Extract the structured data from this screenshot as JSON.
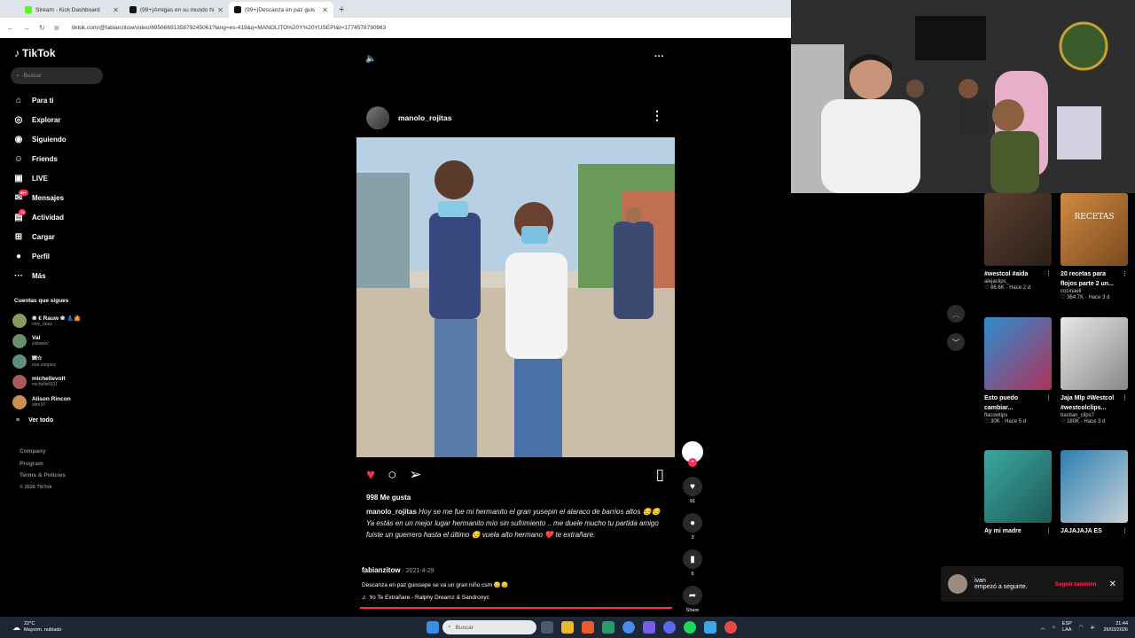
{
  "browser": {
    "tabs": [
      {
        "title": "Stream - Kick Dashboard",
        "color": "#53fc18",
        "active": false
      },
      {
        "title": "(99+)Amigas en su mundo hist",
        "color": "#111111",
        "active": false
      },
      {
        "title": "(99+)Descanza en paz guis",
        "color": "#111111",
        "active": true
      }
    ],
    "url": "tiktok.com/@fabianzitow/video/6956669135879245061?lang=es-419&q=MANOLITO%20Y%20YUSEPI&t=1774578790963"
  },
  "sidebar": {
    "logo": "TikTok",
    "search_placeholder": "Buscar",
    "nav": [
      {
        "icon": "home-icon",
        "glyph": "⌂",
        "label": "Para ti"
      },
      {
        "icon": "compass-icon",
        "glyph": "◎",
        "label": "Explorar"
      },
      {
        "icon": "following-icon",
        "glyph": "◉",
        "label": "Siguiendo"
      },
      {
        "icon": "friends-icon",
        "glyph": "☺",
        "label": "Friends"
      },
      {
        "icon": "live-icon",
        "glyph": "▣",
        "label": "LIVE"
      },
      {
        "icon": "messages-icon",
        "glyph": "✉",
        "label": "Mensajes",
        "badge": "99+"
      },
      {
        "icon": "activity-icon",
        "glyph": "▤",
        "label": "Actividad",
        "badge": "72"
      },
      {
        "icon": "upload-icon",
        "glyph": "⊞",
        "label": "Cargar"
      },
      {
        "icon": "profile-icon",
        "glyph": "●",
        "label": "Perfil"
      },
      {
        "icon": "more-icon",
        "glyph": "···",
        "label": "Más"
      }
    ],
    "following_title": "Cuentas que sigues",
    "following": [
      {
        "name": "❀ € Rauw ❀ 👗🤷",
        "handle": "only_rauw",
        "color": "#8a9a5b"
      },
      {
        "name": "Val",
        "handle": "ysliawvv",
        "color": "#6b8e6b"
      },
      {
        "name": "𝕸☆",
        "handle": "mar.vargasc",
        "color": "#5f8f80"
      },
      {
        "name": "michellevolt",
        "handle": "michelleil101",
        "color": "#a85a5a"
      },
      {
        "name": "Alison Rincon",
        "handle": "aiire10",
        "color": "#c89050"
      }
    ],
    "see_all": "Ver todo",
    "footer": [
      "Company",
      "Program",
      "Terms & Policies"
    ],
    "copyright": "© 2026 TikTok"
  },
  "post": {
    "username": "manolo_rojitas",
    "likes": "998 Me gusta",
    "caption_user": "manolo_rojitas",
    "caption_text": " Hoy se me fue mi hermanito el gran yusepin el alaraco de barrios altos 😔😔 Ya estás en un mejor lugar hermanito mío sin sufrimiento .. me duele mucho tu partida amigo fuiste un guerrero hasta el último 😔 vuela alto hermano ❤️ te extrañare."
  },
  "video": {
    "author": "fabianzitow",
    "date": " · 2021-4-29",
    "description": "Descanza en paz guissepe se va un gran niño csm 😔😔",
    "music": "Yo Te Extrañare - Ralphy Dreamz & Sandronyc",
    "likes": "91",
    "comments": "3",
    "saves": "6",
    "share_label": "Share"
  },
  "suggestions": [
    {
      "title": "#westcol #aida",
      "author": "alejaclips_",
      "likes": "86.6K",
      "ago": "Hace 2 d",
      "color1": "#5c4030",
      "color2": "#2a1f18"
    },
    {
      "title": "20 recetas para flojos parte 2 un...",
      "author": "cocinaeli",
      "likes": "364.7K",
      "ago": "Hace 3 d",
      "color1": "#d08a40",
      "color2": "#7a4a20",
      "overlay": "RECETAS"
    },
    {
      "title": "Esto puedo cambiar...",
      "author": "flacowtips",
      "likes": "30K",
      "ago": "Hace 5 d",
      "color1": "#2a8fd0",
      "color2": "#b0305a"
    },
    {
      "title": "Jaja Mlp #Westcol #westcolclips...",
      "author": "bastian_clips7",
      "likes": "180K",
      "ago": "Hace 3 d",
      "color1": "#e8e8e8",
      "color2": "#888888"
    },
    {
      "title": "Ay mi madre",
      "author": "",
      "likes": "",
      "ago": "",
      "color1": "#3aa8a0",
      "color2": "#1d5a58"
    },
    {
      "title": "JAJAJAJA ES",
      "author": "",
      "likes": "",
      "ago": "",
      "color1": "#2a7fb0",
      "color2": "#c8d0d8"
    }
  ],
  "toast": {
    "name": "ivan",
    "message": "empezó a seguirte.",
    "button": "Seguir también"
  },
  "taskbar": {
    "temp": "22°C",
    "weather": "Mayorm. nublado",
    "search": "Buscar",
    "lang1": "ESP",
    "lang2": "LAA",
    "time": "21:44",
    "date": "26/03/2026"
  }
}
